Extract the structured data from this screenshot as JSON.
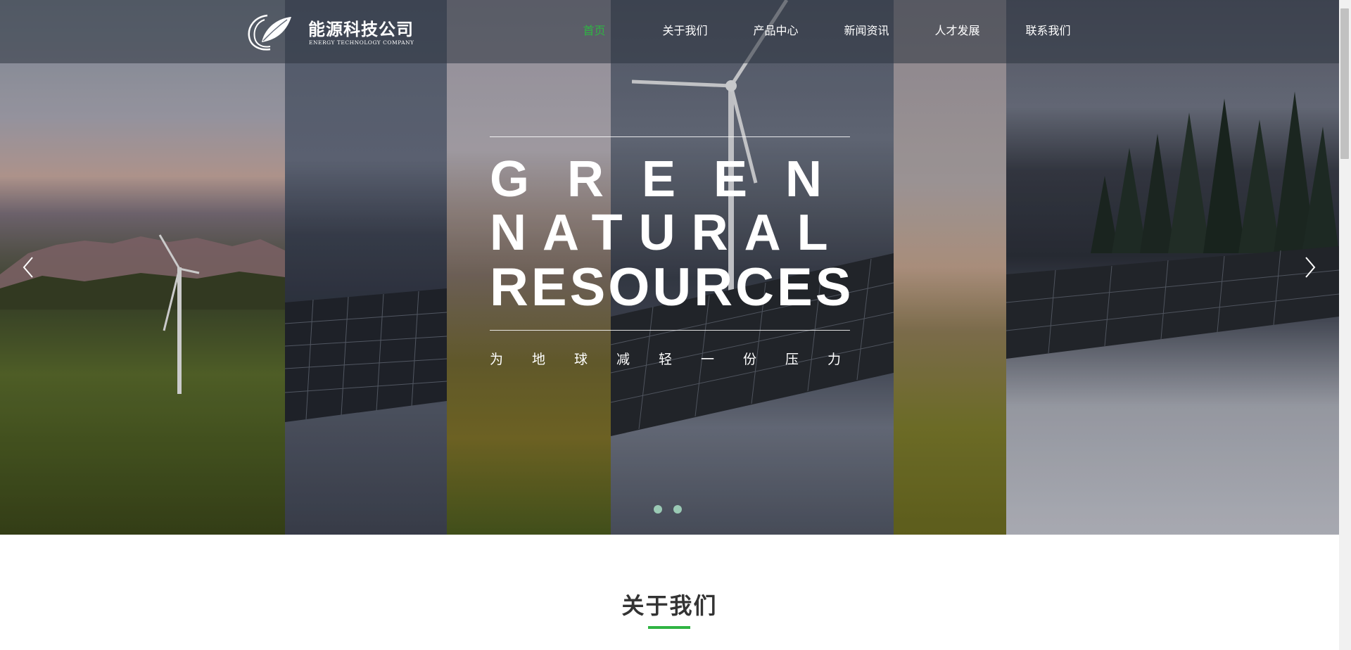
{
  "brand": {
    "name_cn": "能源科技公司",
    "name_en": "ENERGY TECHNOLOGY COMPANY"
  },
  "nav": {
    "items": [
      {
        "label": "首页",
        "active": true
      },
      {
        "label": "关于我们",
        "active": false
      },
      {
        "label": "产品中心",
        "active": false
      },
      {
        "label": "新闻资讯",
        "active": false
      },
      {
        "label": "人才发展",
        "active": false
      },
      {
        "label": "联系我们",
        "active": false
      }
    ]
  },
  "hero": {
    "line1": "GREEN",
    "line2": "NATURAL",
    "line3": "RESOURCES",
    "tagline": "为地球减轻一份压力",
    "slide_count": 2,
    "active_slide": 1
  },
  "about": {
    "title": "关于我们"
  },
  "colors": {
    "accent": "#2fb443",
    "header_bg": "rgba(45,52,64,0.55)",
    "dot": "#9ac9b4",
    "heading": "#333333"
  },
  "icons": {
    "logo": "leaf-swirl-logo",
    "prev": "chevron-left-icon",
    "next": "chevron-right-icon"
  }
}
